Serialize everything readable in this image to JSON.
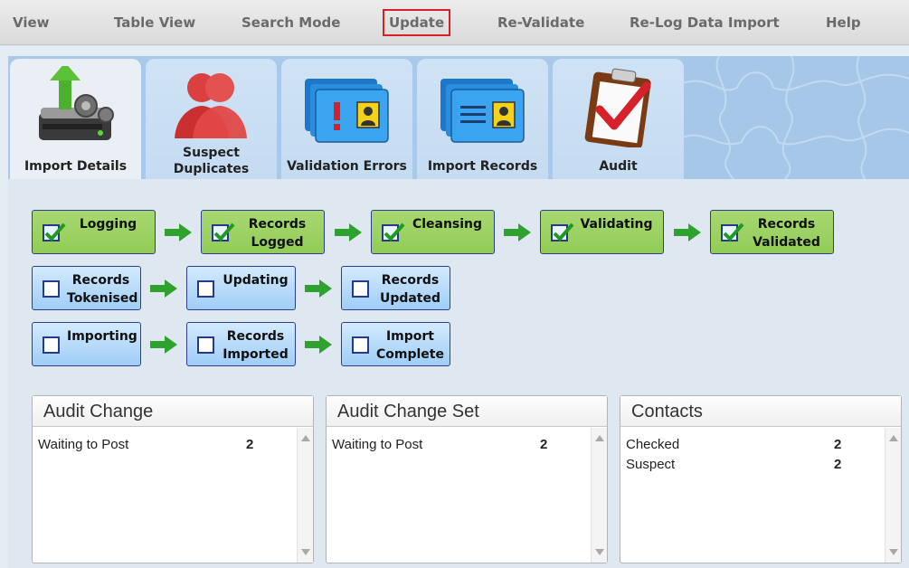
{
  "menu": {
    "items": [
      {
        "label": "View"
      },
      {
        "label": "Table View"
      },
      {
        "label": "Search Mode"
      },
      {
        "label": "Update"
      },
      {
        "label": "Re-Validate"
      },
      {
        "label": "Re-Log Data Import"
      },
      {
        "label": "Help"
      }
    ],
    "highlighted": "Update",
    "highlight_color": "#d6202a"
  },
  "tabs": [
    {
      "label": "Import Details",
      "icon": "server-upload-icon",
      "active": true
    },
    {
      "label": "Suspect Duplicates",
      "icon": "duplicate-people-icon",
      "active": false
    },
    {
      "label": "Validation Errors",
      "icon": "folder-error-icon",
      "active": false
    },
    {
      "label": "Import Records",
      "icon": "folder-records-icon",
      "active": false
    },
    {
      "label": "Audit",
      "icon": "clipboard-check-icon",
      "active": false
    }
  ],
  "workflow": {
    "steps": [
      {
        "label": "Logging",
        "done": true
      },
      {
        "label": "Records Logged",
        "done": true
      },
      {
        "label": "Cleansing",
        "done": true
      },
      {
        "label": "Validating",
        "done": true
      },
      {
        "label": "Records Validated",
        "done": true
      },
      {
        "label": "Records Tokenised",
        "done": false
      },
      {
        "label": "Updating",
        "done": false
      },
      {
        "label": "Records Updated",
        "done": false
      },
      {
        "label": "Importing",
        "done": false
      },
      {
        "label": "Records Imported",
        "done": false
      },
      {
        "label": "Import Complete",
        "done": false
      }
    ],
    "done_color": "#9bd163",
    "todo_color": "#b9ddfa"
  },
  "panels": [
    {
      "title": "Audit Change",
      "rows": [
        {
          "label": "Waiting to Post",
          "value": "2"
        }
      ]
    },
    {
      "title": "Audit Change Set",
      "rows": [
        {
          "label": "Waiting to Post",
          "value": "2"
        }
      ]
    },
    {
      "title": "Contacts",
      "rows": [
        {
          "label": "Checked",
          "value": "2"
        },
        {
          "label": "Suspect",
          "value": "2"
        }
      ]
    }
  ]
}
